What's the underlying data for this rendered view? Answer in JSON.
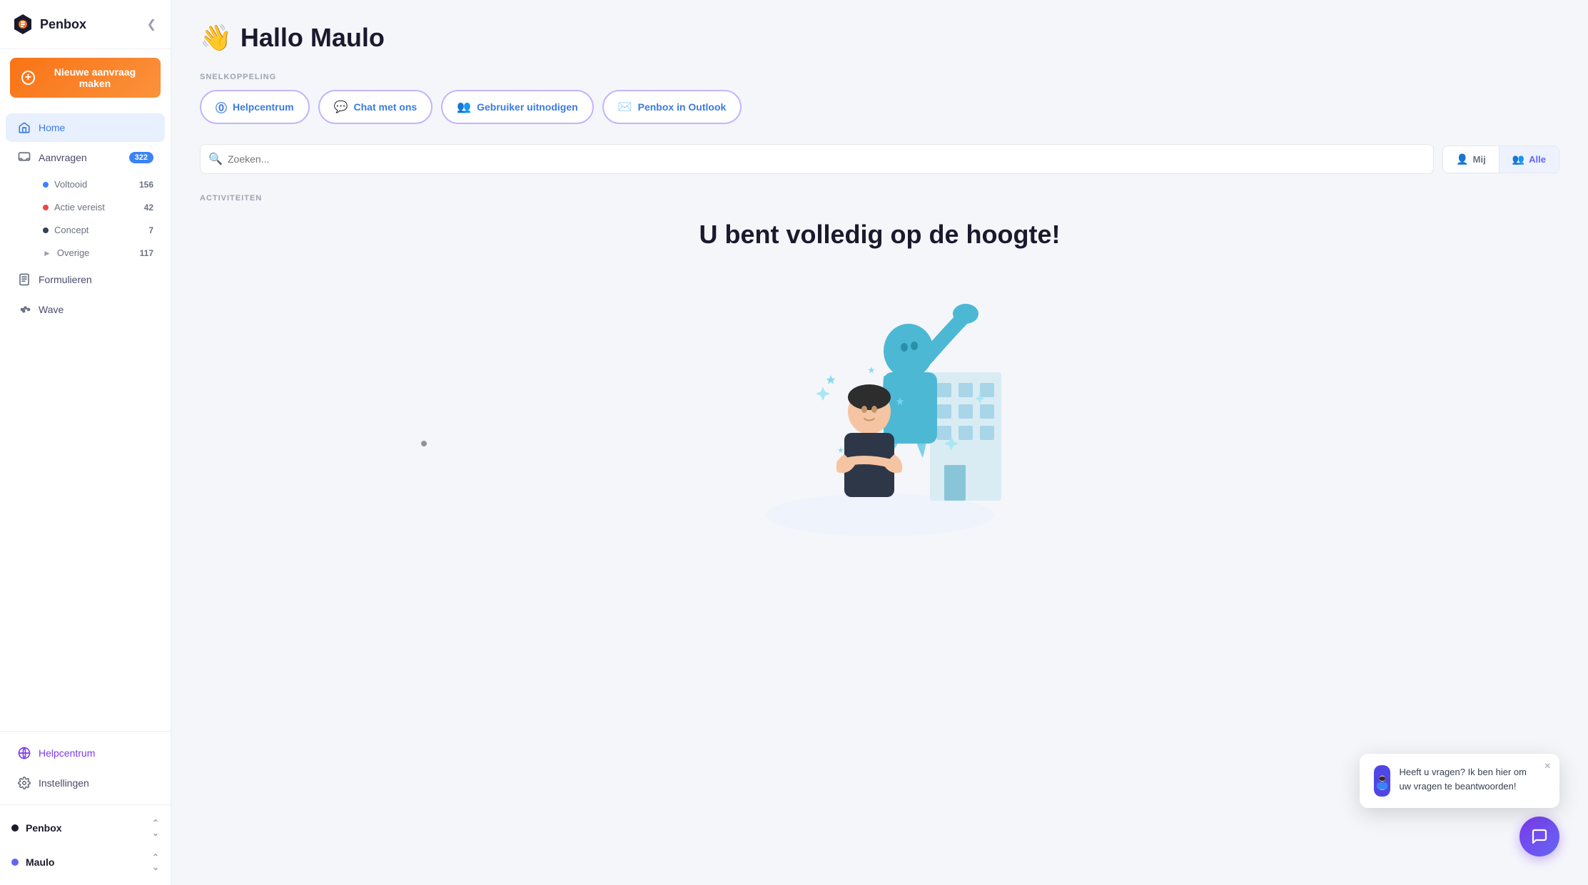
{
  "brand": {
    "name": "Penbox"
  },
  "sidebar": {
    "collapse_label": "Collapse sidebar",
    "new_request_label": "Nieuwe aanvraag maken",
    "nav_items": [
      {
        "id": "home",
        "label": "Home",
        "icon": "home",
        "active": true
      },
      {
        "id": "aanvragen",
        "label": "Aanvragen",
        "icon": "inbox",
        "badge": "322",
        "badge_color": "blue"
      }
    ],
    "sub_items": [
      {
        "id": "voltooid",
        "label": "Voltooid",
        "dot_color": "#3b82f6",
        "badge": "156"
      },
      {
        "id": "actie-vereist",
        "label": "Actie vereist",
        "dot_color": "#ef4444",
        "badge": "42"
      },
      {
        "id": "concept",
        "label": "Concept",
        "dot_color": "#374151",
        "badge": "7"
      },
      {
        "id": "overige",
        "label": "Overige",
        "expand": true,
        "badge": "117"
      }
    ],
    "other_nav": [
      {
        "id": "formulieren",
        "label": "Formulieren",
        "icon": "file"
      },
      {
        "id": "wave",
        "label": "Wave",
        "icon": "wave"
      }
    ],
    "footer_items": [
      {
        "id": "helpcentrum",
        "label": "Helpcentrum",
        "icon": "globe",
        "color": "purple"
      },
      {
        "id": "instellingen",
        "label": "Instellingen",
        "icon": "gear"
      }
    ],
    "user_items": [
      {
        "id": "penbox",
        "label": "Penbox"
      },
      {
        "id": "maulo",
        "label": "Maulo"
      }
    ]
  },
  "main": {
    "greeting": "Hallo Maulo",
    "wave_emoji": "👋",
    "snelkoppeling_label": "SNELKOPPELING",
    "quick_links": [
      {
        "id": "helpcentrum",
        "label": "Helpcentrum",
        "icon": "❓"
      },
      {
        "id": "chat-met-ons",
        "label": "Chat met ons",
        "icon": "💬"
      },
      {
        "id": "gebruiker-uitnodigen",
        "label": "Gebruiker uitnodigen",
        "icon": "👥"
      },
      {
        "id": "penbox-in-outlook",
        "label": "Penbox in Outlook",
        "icon": "✉️"
      }
    ],
    "search": {
      "placeholder": "Zoeken..."
    },
    "filter_buttons": [
      {
        "id": "mij",
        "label": "Mij",
        "icon": "👤",
        "active": false
      },
      {
        "id": "alle",
        "label": "Alle",
        "icon": "👥",
        "active": true
      }
    ],
    "activities_label": "ACTIVITEITEN",
    "all_good_title": "U bent volledig op de hoogte!"
  },
  "chat_widget": {
    "popup_text": "Heeft u vragen? Ik ben hier om uw vragen te beantwoorden!",
    "close_label": "×",
    "fab_icon": "💬"
  }
}
